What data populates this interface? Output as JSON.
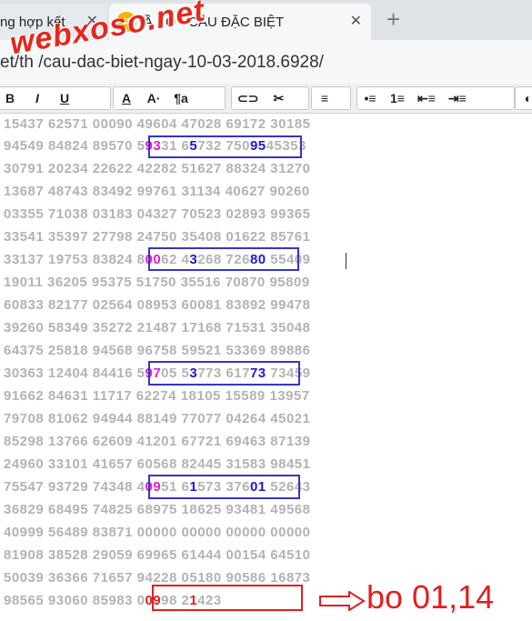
{
  "tabs": [
    {
      "label": "ng hợp kết",
      "close": "✕"
    },
    {
      "favicon": "XS",
      "label": "CẦU BẠCH THỦ LÔ ĐỀ - CẦU ĐẶC BIỆT",
      "shown": "Ầ  ÈO - CẦU ĐẶC BIỆT",
      "close": "✕"
    }
  ],
  "new_tab": "+",
  "address": "et/th      /cau-dac-biet-ngay-10-03-2018.6928/",
  "watermark": "webxoso.net",
  "toolbar": {
    "icons": [
      "bold-icon",
      "italic-icon",
      "underline-icon",
      "font-color-icon",
      "font-size-icon",
      "font-family-icon",
      "link-icon",
      "unlink-icon",
      "align-icon",
      "bullet-list-icon",
      "numbered-list-icon",
      "outdent-icon",
      "indent-icon",
      "more-icon"
    ],
    "labels": [
      "B",
      "I",
      "U",
      "A",
      "A·",
      "¶a",
      "⊂⊃",
      "✂",
      "≡",
      "•≡",
      "1≡",
      "⇤≡",
      "⇥≡",
      "◐"
    ]
  },
  "rows": [
    [
      {
        "t": "15437 62571 00090 49604 47028 69172 30185"
      }
    ],
    [
      {
        "t": "94549 84824 89570 5"
      },
      {
        "t": "93",
        "c": "m"
      },
      {
        "t": "31 6"
      },
      {
        "t": "5",
        "c": "b"
      },
      {
        "t": "732 750"
      },
      {
        "t": "95",
        "c": "b"
      },
      {
        "t": "45353"
      }
    ],
    [
      {
        "t": "30791 20234 22622 42282 51627 88324 31270"
      }
    ],
    [
      {
        "t": "13687 48743 83492 99761 31134 40627 90260"
      }
    ],
    [
      {
        "t": "03355 71038 03183 04327 70523 02893 99365"
      }
    ],
    [
      {
        "t": "33541 35397 27798 24750 35408 01622 85761"
      }
    ],
    [
      {
        "t": "33137 19753 83824 8"
      },
      {
        "t": "00",
        "c": "m"
      },
      {
        "t": "62 4"
      },
      {
        "t": "3",
        "c": "b"
      },
      {
        "t": "268 726"
      },
      {
        "t": "80",
        "c": "b"
      },
      {
        "t": " 55409"
      }
    ],
    [
      {
        "t": "19011 36205 95375 51750 35516 70870 95809"
      }
    ],
    [
      {
        "t": "60833 82177 02564 08953 60081 83892 99478"
      }
    ],
    [
      {
        "t": "39260 58349 35272 21487 17168 71531 35048"
      }
    ],
    [
      {
        "t": "64375 25818 94568 96758 59521 53369 89886"
      }
    ],
    [
      {
        "t": "30363 12404 84416 5"
      },
      {
        "t": "97",
        "c": "m"
      },
      {
        "t": "05 5"
      },
      {
        "t": "3",
        "c": "b"
      },
      {
        "t": "773 617"
      },
      {
        "t": "73",
        "c": "b"
      },
      {
        "t": " 73459"
      }
    ],
    [
      {
        "t": "91662 84631 11717 62274 18105 15589 13957"
      }
    ],
    [
      {
        "t": "79708 81062 94944 88149 77077 04264 45021"
      }
    ],
    [
      {
        "t": "85298 13766 62609 41201 67721 69463 87139"
      }
    ],
    [
      {
        "t": "24960 33101 41657 60568 82445 31583 98451"
      }
    ],
    [
      {
        "t": "75547 93729 74348 4"
      },
      {
        "t": "09",
        "c": "m"
      },
      {
        "t": "51 6"
      },
      {
        "t": "1",
        "c": "b"
      },
      {
        "t": "573 376"
      },
      {
        "t": "01",
        "c": "b"
      },
      {
        "t": " 52643"
      }
    ],
    [
      {
        "t": "36829 68495 74825 68975 18625 93481 49568"
      }
    ],
    [
      {
        "t": "40999 56489 83871 00000 00000 00000 00000"
      }
    ],
    [
      {
        "t": "81908 38528 29059 69965 61444 00154 64510"
      }
    ],
    [
      {
        "t": "50039 36366 71657 94228 05180 90586 16873"
      }
    ],
    [
      {
        "t": "98565 93060 85983 0"
      },
      {
        "t": "09",
        "c": "r"
      },
      {
        "t": "98 2"
      },
      {
        "t": "1",
        "c": "r"
      },
      {
        "t": "423"
      }
    ]
  ],
  "annotation": "bo 01,14",
  "colors": {
    "magenta": "#e020d0",
    "blue": "#1b1bd0",
    "red": "#e02020",
    "grey": "#b3b3b3"
  }
}
